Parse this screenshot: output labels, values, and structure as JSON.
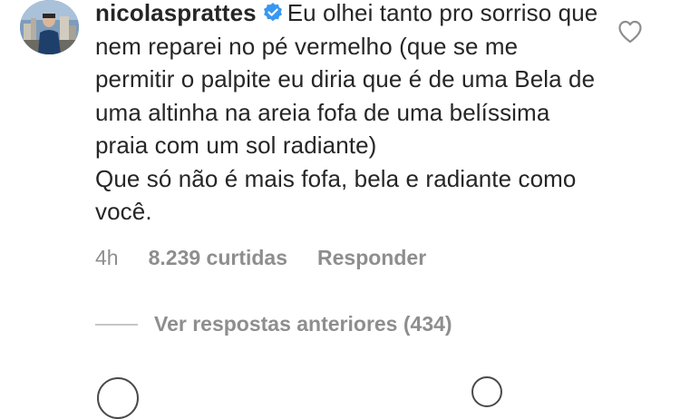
{
  "comment": {
    "username": "nicolasprattes",
    "verified": true,
    "paragraph1": "Eu olhei tanto pro sorriso que nem reparei no pé vermelho (que se me permitir o palpite eu diria que é de uma Bela de uma altinha na areia fofa de uma belíssima praia com um sol radiante)",
    "paragraph2": "Que só não é mais fofa, bela e radiante como você.",
    "time": "4h",
    "likes": "8.239 curtidas",
    "reply_label": "Responder"
  },
  "replies": {
    "view_label": "Ver respostas anteriores (434)"
  },
  "icons": {
    "avatar": "profile-photo",
    "verified": "verified-badge-icon",
    "like": "heart-outline-icon"
  },
  "colors": {
    "text": "#262626",
    "muted": "#8e8e8e",
    "verified_blue": "#3897f0",
    "divider": "#c7c7c7"
  }
}
